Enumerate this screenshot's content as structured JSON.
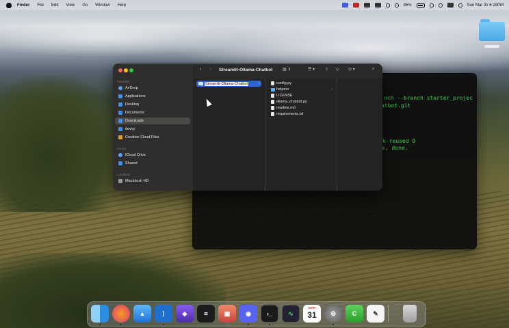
{
  "menubar": {
    "app_name": "Finder",
    "menus": [
      "File",
      "Edit",
      "View",
      "Go",
      "Window",
      "Help"
    ],
    "battery": "85%",
    "datetime": "Sun Mar 31  5:19PM"
  },
  "finder": {
    "title": "Streamlit-Ollama-Chatbot",
    "sidebar": {
      "favorites_header": "Favorites",
      "favorites": [
        "AirDrop",
        "Applications",
        "Desktop",
        "Documents",
        "Downloads",
        "devvy",
        "Creative Cloud Files"
      ],
      "icloud_header": "iCloud",
      "icloud": [
        "iCloud Drive",
        "Shared"
      ],
      "locations_header": "Locations",
      "locations": [
        "Macintosh HD"
      ]
    },
    "column1": {
      "rename_value": "Streamlit-Ollama-Chatbot"
    },
    "column2": {
      "items": [
        "config.py",
        "helpers",
        "LICENSE",
        "ollama_chatbot.py",
        "readme.md",
        "requirements.txt"
      ]
    }
  },
  "terminal": {
    "lines": [
      "nch --branch starter_projec",
      "atbot.git",
      "k-reused 0",
      "s, done."
    ]
  },
  "dock": {
    "apps": [
      "Finder",
      "Firefox",
      "Xcode",
      "Visual Studio Code",
      "Obsidian",
      "Screenshot",
      "Package",
      "Discord",
      "Terminal",
      "Activity Monitor",
      "Calendar",
      "System Settings",
      "Android Studio",
      "TextEdit",
      "Trash"
    ],
    "calendar_month": "MAR",
    "calendar_day": "31"
  },
  "colors": {
    "finder_selection": "#2c63d6",
    "terminal_text": "#3fd24a",
    "folder_blue": "#5fb0ee"
  }
}
